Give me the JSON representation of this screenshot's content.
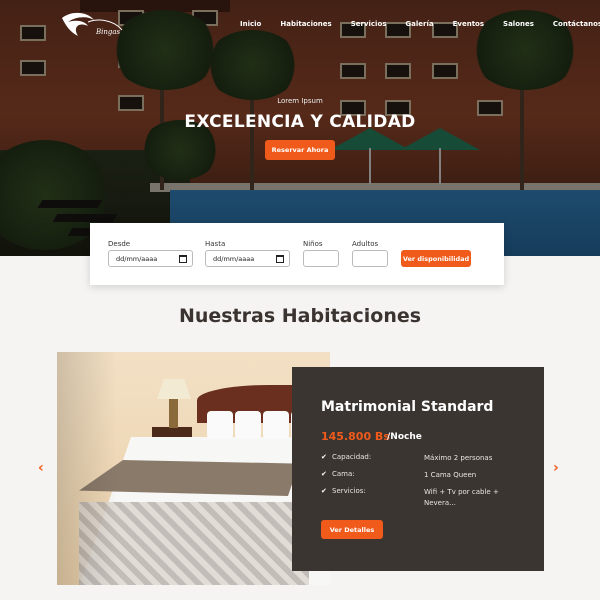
{
  "nav": {
    "items": [
      "Inicio",
      "Habitaciones",
      "Servicios",
      "Galería",
      "Eventos",
      "Salones",
      "Contáctanos"
    ]
  },
  "hero": {
    "eyebrow": "Lorem Ipsum",
    "title": "EXCELENCIA Y CALIDAD",
    "cta": "Reservar Ahora"
  },
  "booking": {
    "from_label": "Desde",
    "from_value": "dd/mm/aaaa",
    "to_label": "Hasta",
    "to_value": "dd/mm/aaaa",
    "children_label": "Niños",
    "adults_label": "Adultos",
    "button": "Ver disponibilidad"
  },
  "rooms": {
    "section_title": "Nuestras Habitaciones",
    "room": {
      "name": "Matrimonial Standard",
      "price": "145.800 Bs",
      "unit": "/Noche",
      "specs": [
        {
          "label": "Capacidad:",
          "value": "Máximo 2 personas"
        },
        {
          "label": "Cama:",
          "value": "1 Cama Queen"
        },
        {
          "label": "Servicios:",
          "value": "Wifi + Tv por cable + Nevera..."
        }
      ],
      "button": "Ver Detalles"
    }
  },
  "icons": {
    "check": "check-icon",
    "prev": "chevron-left-icon",
    "next": "chevron-right-icon",
    "calendar": "calendar-icon"
  },
  "colors": {
    "accent": "#f05a1a",
    "card_bg": "#3b3532",
    "page_bg": "#f5f4f2"
  }
}
